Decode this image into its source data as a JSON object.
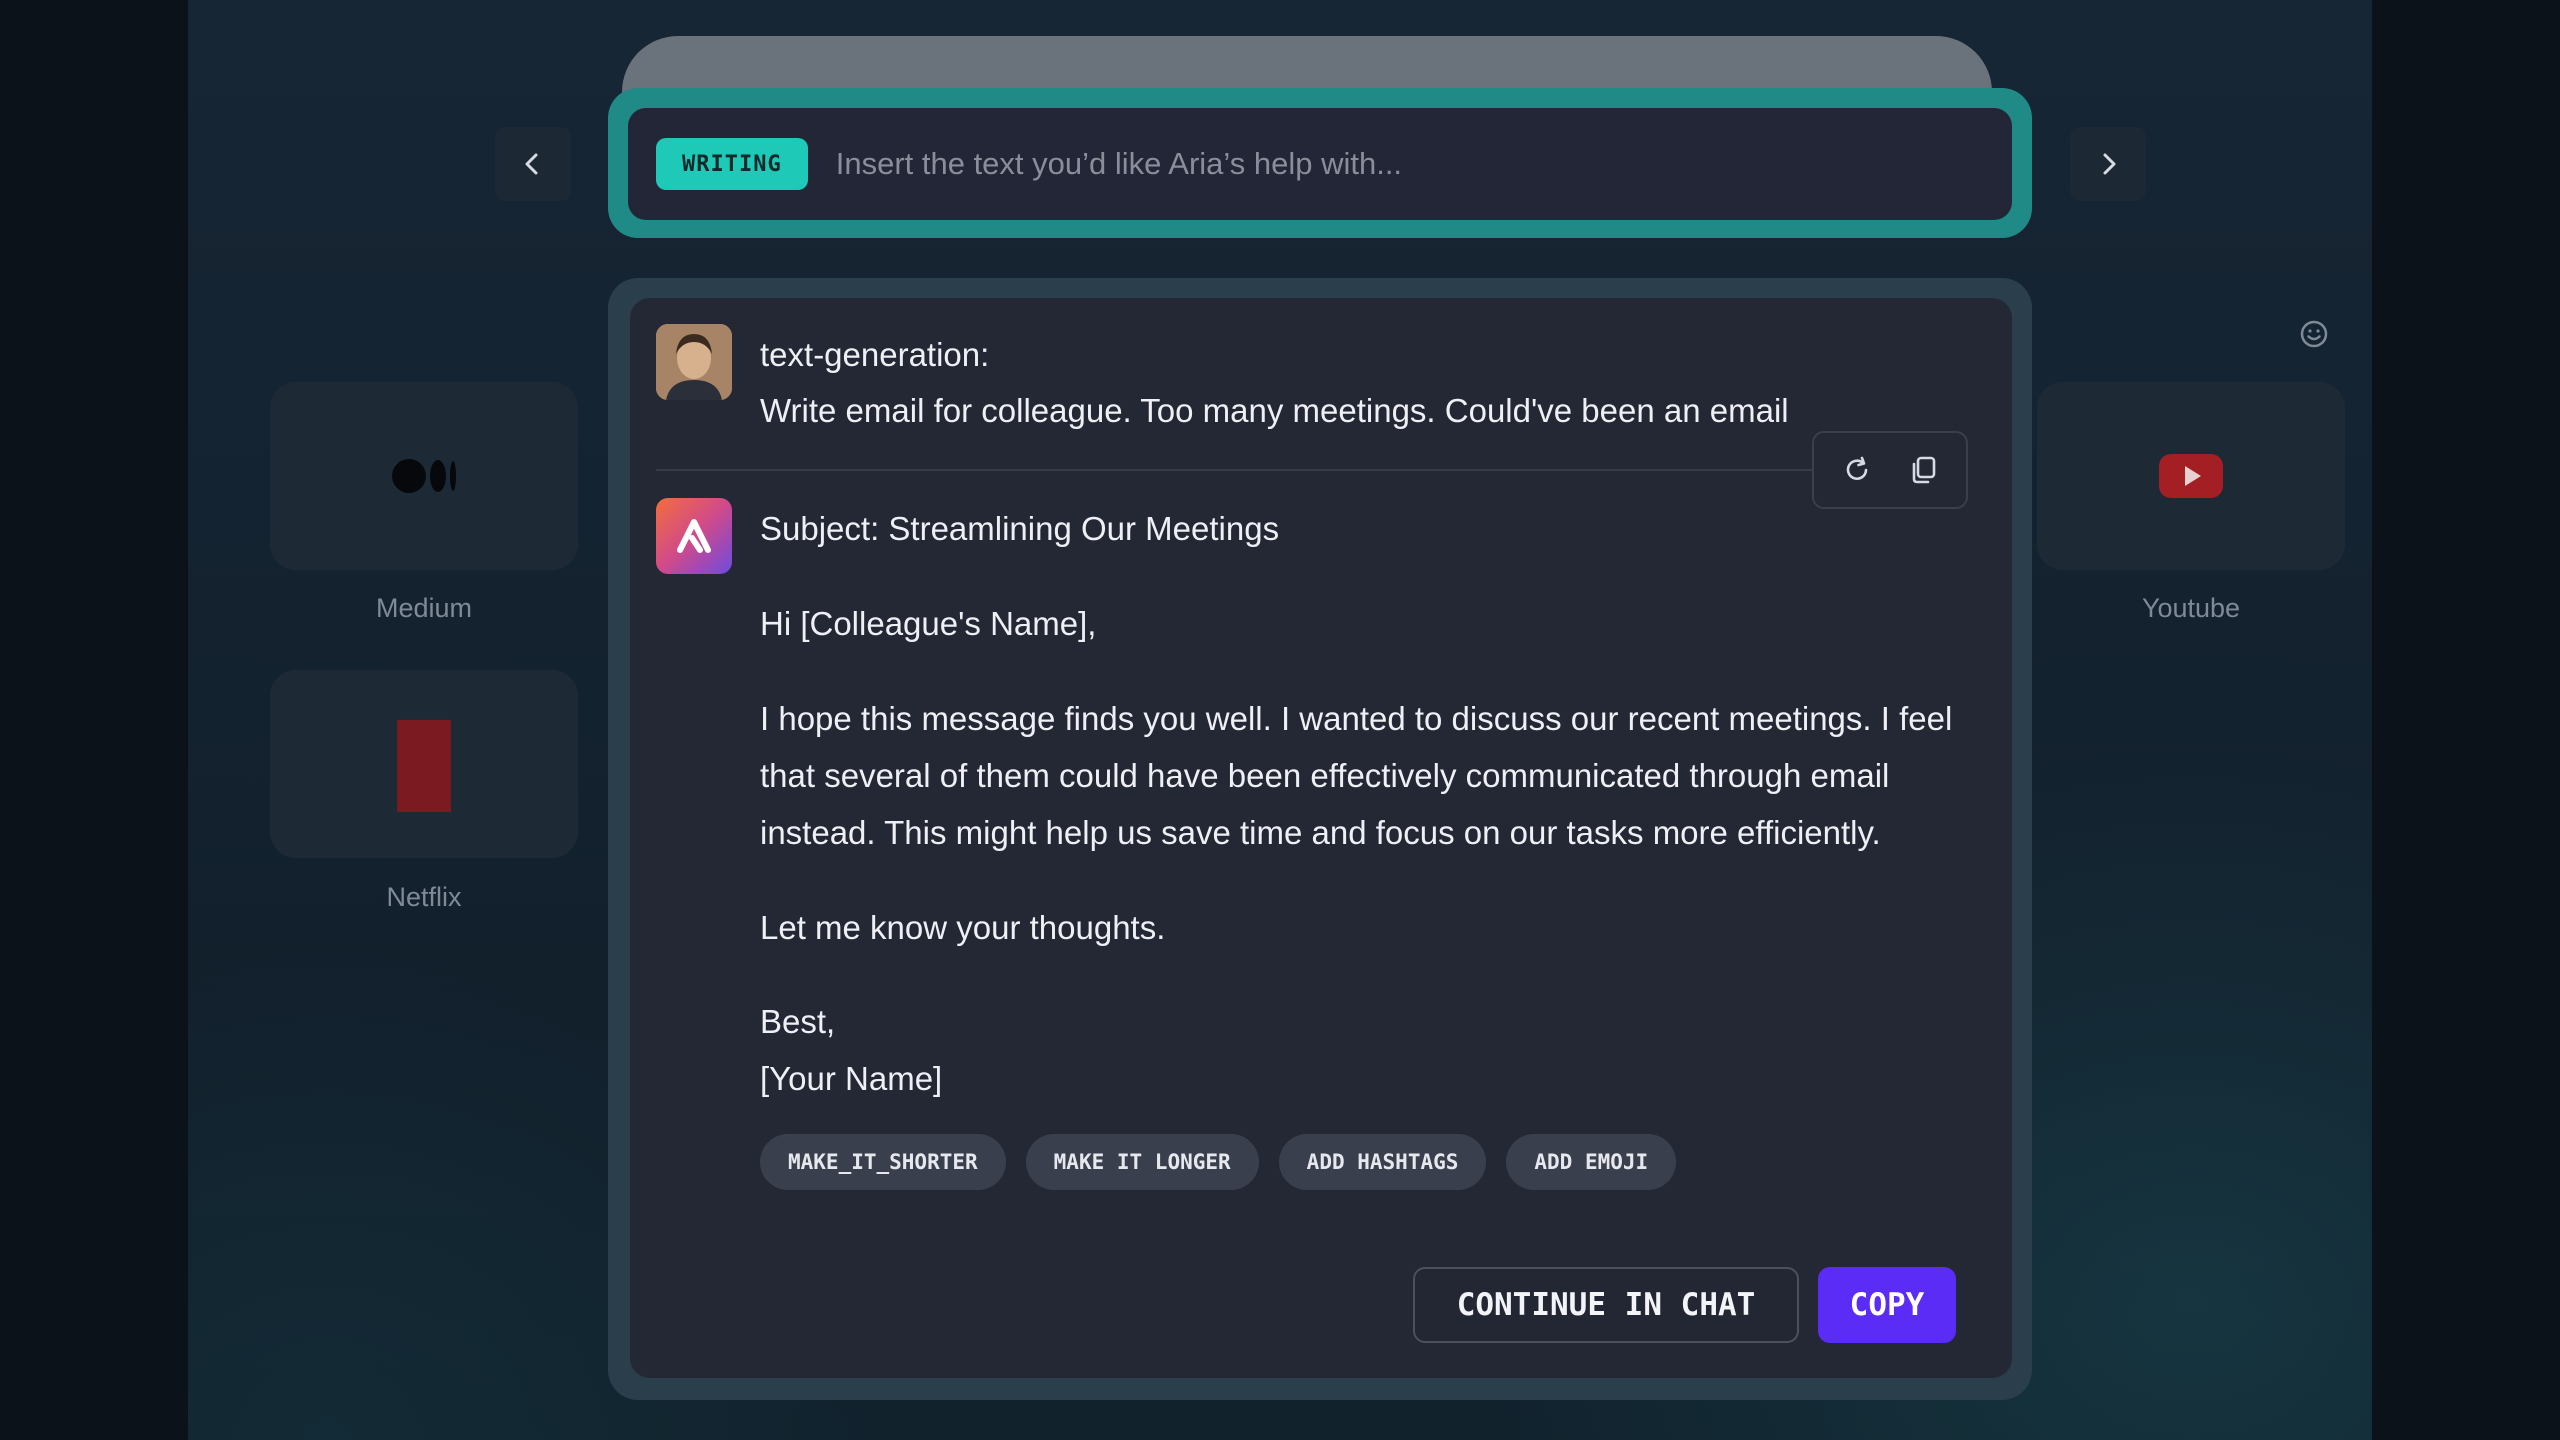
{
  "search": {
    "mode_badge": "WRITING",
    "placeholder": "Insert the text you’d like Aria’s help with...",
    "value": ""
  },
  "tiles": {
    "medium": "Medium",
    "netflix": "Netflix",
    "youtube": "Youtube"
  },
  "prompt": {
    "label": "text-generation:",
    "text": "Write email for colleague. Too many meetings. Could've been an email"
  },
  "response": {
    "subject": "Subject: Streamlining Our Meetings",
    "greeting": "Hi [Colleague's Name],",
    "body": "I hope this message finds you well. I wanted to discuss our recent meetings. I feel that several of them could have been effectively communicated through email instead. This might help us save time and focus on our tasks more efficiently.",
    "closing": "Let me know your thoughts.",
    "signoff": "Best,",
    "name": "[Your Name]"
  },
  "chips": [
    "MAKE_IT_SHORTER",
    "MAKE IT LONGER",
    "ADD HASHTAGS",
    "ADD EMOJI"
  ],
  "actions": {
    "continue_label": "CONTINUE IN CHAT",
    "copy_label": "COPY"
  },
  "colors": {
    "accent_teal": "#1ec9b7",
    "primary_button": "#5b2cf5",
    "frame_teal": "#1f8a86"
  },
  "icons": {
    "prev": "chevron-left-icon",
    "next": "chevron-right-icon",
    "regenerate": "refresh-icon",
    "copy": "copy-icon",
    "feedback": "smile-icon"
  }
}
